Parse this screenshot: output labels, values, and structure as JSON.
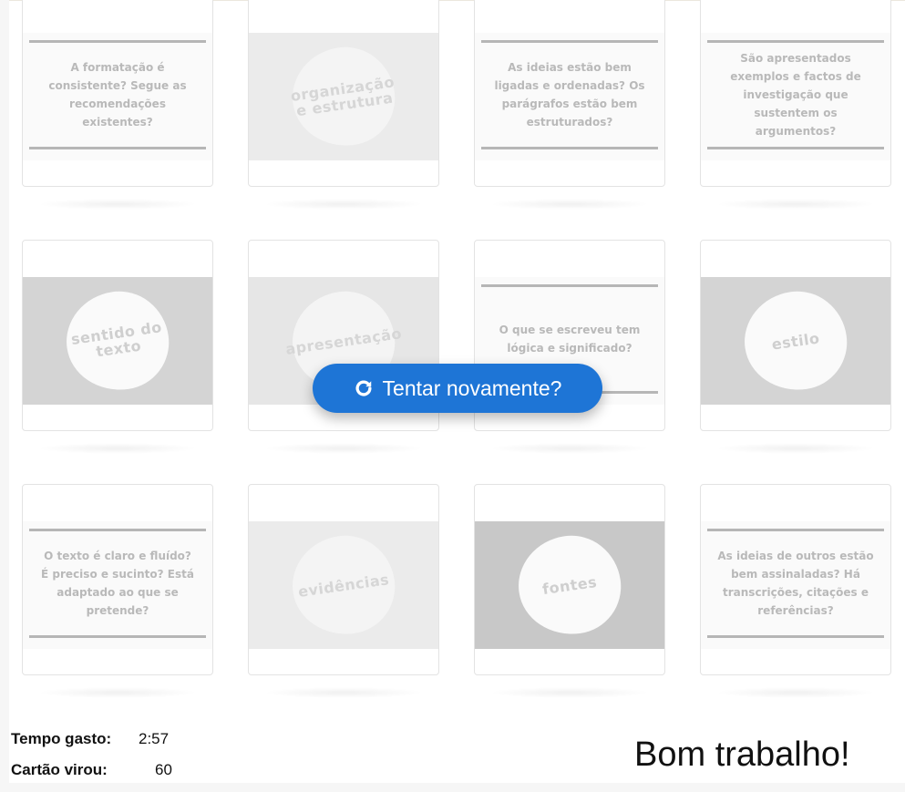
{
  "cards": [
    {
      "type": "text",
      "text": "A formatação é consistente? Segue as recomendações existentes?"
    },
    {
      "type": "image",
      "word": "organização e estrutura",
      "shade": "light"
    },
    {
      "type": "text",
      "text": "As ideias estão bem ligadas e ordenadas? Os parágrafos estão bem estruturados?"
    },
    {
      "type": "text",
      "text": "São apresentados exemplos e factos de investigação que sustentem os argumentos?"
    },
    {
      "type": "image",
      "word": "sentido do texto",
      "shade": "dark"
    },
    {
      "type": "image",
      "word": "apresentação",
      "shade": "mid"
    },
    {
      "type": "text",
      "text": "O que se escreveu tem lógica e significado?"
    },
    {
      "type": "image",
      "word": "estilo",
      "shade": "dark"
    },
    {
      "type": "text",
      "text": "O texto é claro e fluído? É preciso e sucinto? Está adaptado ao que se pretende?"
    },
    {
      "type": "image",
      "word": "evidências",
      "shade": "light"
    },
    {
      "type": "image",
      "word": "fontes",
      "shade": "darker"
    },
    {
      "type": "text",
      "text": "As ideias de outros estão bem assinaladas? Há transcrições, citações e referências?"
    }
  ],
  "retry_button": {
    "label": "Tentar novamente?",
    "icon": "redo-icon"
  },
  "stats": {
    "time_label": "Tempo gasto:",
    "time_value": "2:57",
    "flips_label": "Cartão virou:",
    "flips_value": "60"
  },
  "message": "Bom trabalho!",
  "colors": {
    "accent": "#1e75d6",
    "card_bar": "#b6b6b6",
    "text_faded": "#b9b9b9"
  }
}
